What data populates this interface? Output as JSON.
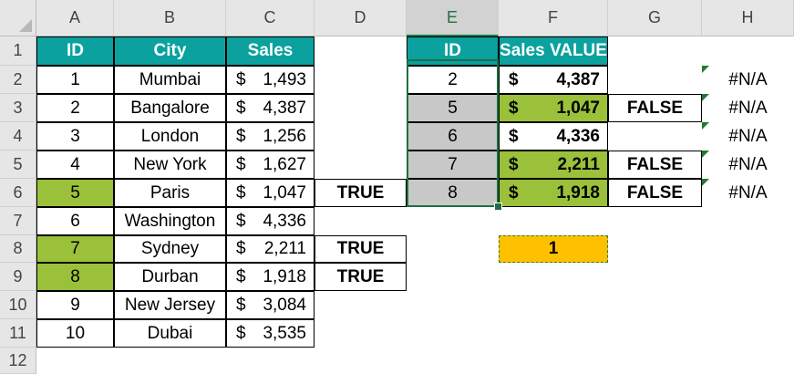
{
  "columns": [
    "A",
    "B",
    "C",
    "D",
    "E",
    "F",
    "G",
    "H"
  ],
  "rows": [
    "1",
    "2",
    "3",
    "4",
    "5",
    "6",
    "7",
    "8",
    "9",
    "10",
    "11",
    "12"
  ],
  "table1": {
    "headers": {
      "id": "ID",
      "city": "City",
      "sales": "Sales"
    },
    "currency": "$",
    "rows": [
      {
        "id": "1",
        "city": "Mumbai",
        "sales": "1,493",
        "flag": ""
      },
      {
        "id": "2",
        "city": "Bangalore",
        "sales": "4,387",
        "flag": ""
      },
      {
        "id": "3",
        "city": "London",
        "sales": "1,256",
        "flag": ""
      },
      {
        "id": "4",
        "city": "New York",
        "sales": "1,627",
        "flag": ""
      },
      {
        "id": "5",
        "city": "Paris",
        "sales": "1,047",
        "flag": "TRUE"
      },
      {
        "id": "6",
        "city": "Washington",
        "sales": "4,336",
        "flag": ""
      },
      {
        "id": "7",
        "city": "Sydney",
        "sales": "2,211",
        "flag": "TRUE"
      },
      {
        "id": "8",
        "city": "Durban",
        "sales": "1,918",
        "flag": "TRUE"
      },
      {
        "id": "9",
        "city": "New Jersey",
        "sales": "3,084",
        "flag": ""
      },
      {
        "id": "10",
        "city": "Dubai",
        "sales": "3,535",
        "flag": ""
      }
    ]
  },
  "table2": {
    "headers": {
      "id": "ID",
      "value": "Sales VALUE"
    },
    "currency": "$",
    "rows": [
      {
        "id": "2",
        "value": "4,387",
        "g": "",
        "h": "#N/A"
      },
      {
        "id": "5",
        "value": "1,047",
        "g": "FALSE",
        "h": "#N/A"
      },
      {
        "id": "6",
        "value": "4,336",
        "g": "",
        "h": "#N/A"
      },
      {
        "id": "7",
        "value": "2,211",
        "g": "FALSE",
        "h": "#N/A"
      },
      {
        "id": "8",
        "value": "1,918",
        "g": "FALSE",
        "h": "#N/A"
      }
    ]
  },
  "result_value": "1",
  "colors": {
    "header_teal": "#0aa19f",
    "highlight_green": "#9bc03a",
    "selected_grey": "#c8c8c8",
    "result_orange": "#ffc000",
    "selection_border": "#1f6e43"
  }
}
